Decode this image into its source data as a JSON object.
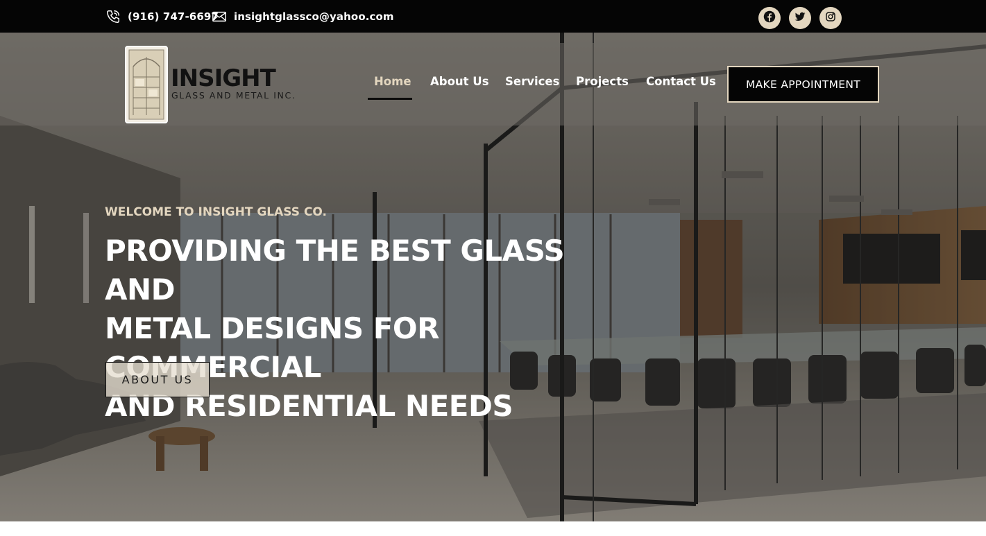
{
  "topbar": {
    "phone": "(916) 747-6697",
    "email": "insightglassco@yahoo.com",
    "phone_icon": "phone-icon",
    "email_icon": "envelope-icon",
    "socials": [
      {
        "icon": "facebook-icon"
      },
      {
        "icon": "twitter-icon"
      },
      {
        "icon": "instagram-icon"
      }
    ]
  },
  "logo": {
    "word": "INSIGHT",
    "sub": "GLASS AND METAL INC."
  },
  "nav": {
    "items": [
      {
        "label": "Home",
        "active": true
      },
      {
        "label": "About Us",
        "active": false
      },
      {
        "label": "Services",
        "active": false
      },
      {
        "label": "Projects",
        "active": false
      },
      {
        "label": "Contact Us",
        "active": false
      }
    ],
    "cta": "MAKE APPOINTMENT"
  },
  "hero": {
    "kicker": "WELCOME TO INSIGHT GLASS CO.",
    "headline_lines": [
      "PROVIDING THE BEST GLASS AND",
      "METAL DESIGNS FOR COMMERCIAL",
      "AND RESIDENTIAL NEEDS"
    ],
    "button": "ABOUT US"
  },
  "colors": {
    "accent": "#e3d6bf",
    "topbar_bg": "#050505",
    "text_light": "#ffffff"
  }
}
